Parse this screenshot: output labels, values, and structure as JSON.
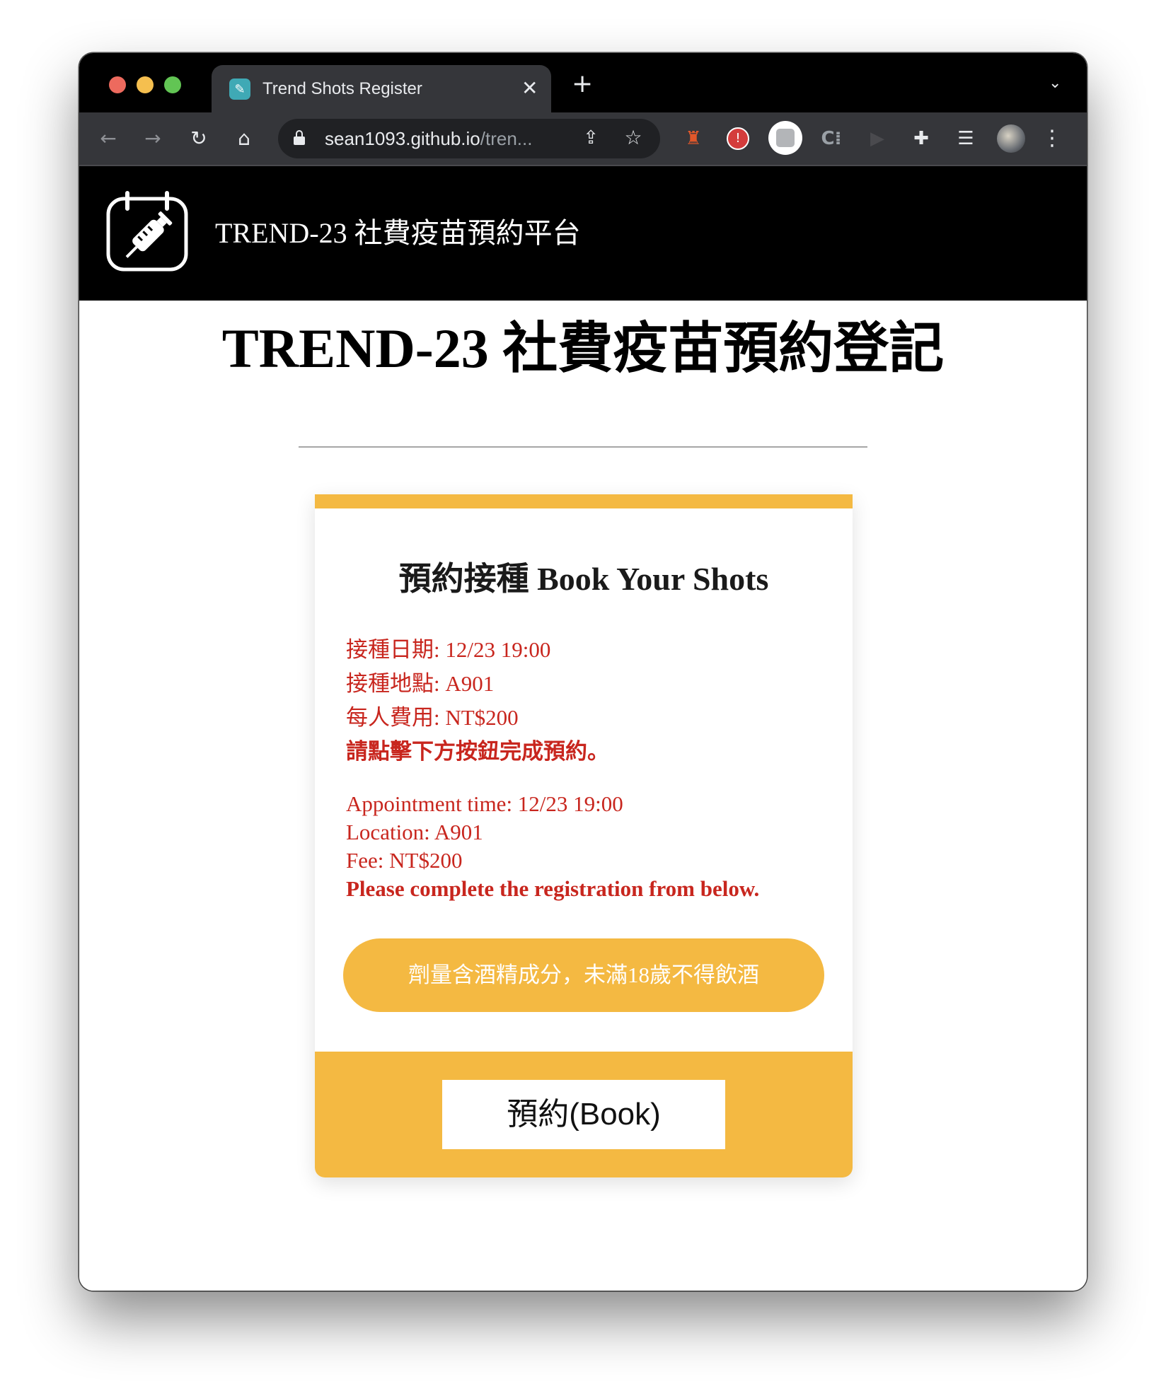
{
  "browser": {
    "tab_title": "Trend Shots Register",
    "tab_close": "✕",
    "new_tab": "+",
    "url_host": "sean1093.github.io",
    "url_path": "/tren..."
  },
  "site": {
    "name": "TREND-23 社費疫苗預約平台"
  },
  "page": {
    "title": "TREND-23 社費疫苗預約登記"
  },
  "card": {
    "heading": "預約接種 Book Your Shots",
    "zh_lines": [
      "接種日期: 12/23 19:00",
      "接種地點: A901",
      "每人費用: NT$200",
      "請點擊下方按鈕完成預約。"
    ],
    "en_lines": [
      "Appointment time: 12/23 19:00",
      "Location: A901",
      "Fee: NT$200",
      "Please complete the registration from below."
    ],
    "notice": "劑量含酒精成分，未滿18歲不得飲酒",
    "book_label": "預約(Book)"
  },
  "colors": {
    "accent": "#f4b942",
    "alert_text": "#c8261e",
    "header_bg": "#000000"
  },
  "icons": {
    "logo": "syringe-calendar-icon",
    "tab_favicon": "syringe-icon"
  }
}
